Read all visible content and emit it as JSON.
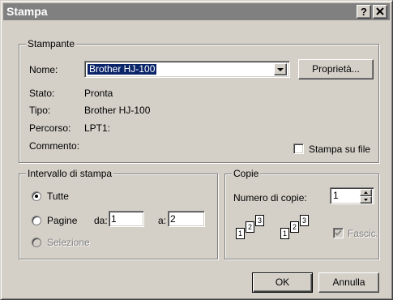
{
  "window": {
    "title": "Stampa",
    "help_button": "?",
    "close_button": "×"
  },
  "printer": {
    "group_label": "Stampante",
    "name_label": "Nome:",
    "name_value": "Brother HJ-100",
    "properties_button": "Proprietà...",
    "status_label": "Stato:",
    "status_value": "Pronta",
    "type_label": "Tipo:",
    "type_value": "Brother HJ-100",
    "path_label": "Percorso:",
    "path_value": "LPT1:",
    "comment_label": "Commento:",
    "print_to_file_label": "Stampa su file",
    "print_to_file_checked": false
  },
  "range": {
    "group_label": "Intervallo di stampa",
    "all_label": "Tutte",
    "pages_label": "Pagine",
    "from_label": "da:",
    "from_value": "1",
    "to_label": "a:",
    "to_value": "2",
    "selection_label": "Selezione",
    "selected": "all"
  },
  "copies": {
    "group_label": "Copie",
    "count_label": "Numero di copie:",
    "count_value": "1",
    "collate_label": "Fascic.",
    "collate_checked": true,
    "collate_enabled": false,
    "icon_pages": [
      "1",
      "2",
      "3"
    ]
  },
  "buttons": {
    "ok": "OK",
    "cancel": "Annulla"
  }
}
